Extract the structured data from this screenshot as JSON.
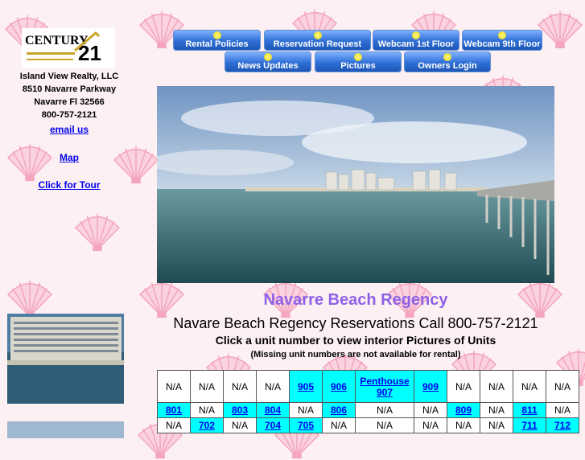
{
  "sidebar": {
    "address": [
      "Island View Realty, LLC",
      "8510 Navarre Parkway",
      "Navarre Fl 32566",
      "800-757-2121"
    ],
    "email_link": "email us",
    "map_link": "Map",
    "tour_link": "Click for Tour"
  },
  "nav": {
    "row1": [
      "Rental Policies",
      "Reservation Request",
      "Webcam 1st Floor",
      "Webcam 9th Floor"
    ],
    "row2": [
      "News Updates",
      "Pictures",
      "Owners Login"
    ]
  },
  "main": {
    "heading": "Navarre Beach Regency",
    "reservations": "Navare Beach Regency Reservations Call 800-757-2121",
    "instruction": "Click a unit number to view interior Pictures of Units",
    "note": "(Missing unit numbers are not available for rental)"
  },
  "units": {
    "rows": [
      [
        "N/A",
        "N/A",
        "N/A",
        "N/A",
        "905",
        "906",
        "Penthouse 907",
        "909",
        "N/A",
        "N/A",
        "N/A",
        "N/A"
      ],
      [
        "801",
        "N/A",
        "803",
        "804",
        "N/A",
        "806",
        "N/A",
        "N/A",
        "809",
        "N/A",
        "811",
        "N/A"
      ],
      [
        "N/A",
        "702",
        "N/A",
        "704",
        "705",
        "N/A",
        "N/A",
        "N/A",
        "N/A",
        "N/A",
        "711",
        "712"
      ]
    ]
  },
  "colors": {
    "heading": "#8e62e8",
    "link": "#0000ee",
    "unit_highlight": "#00ffff",
    "button": "#2e6fd6"
  }
}
